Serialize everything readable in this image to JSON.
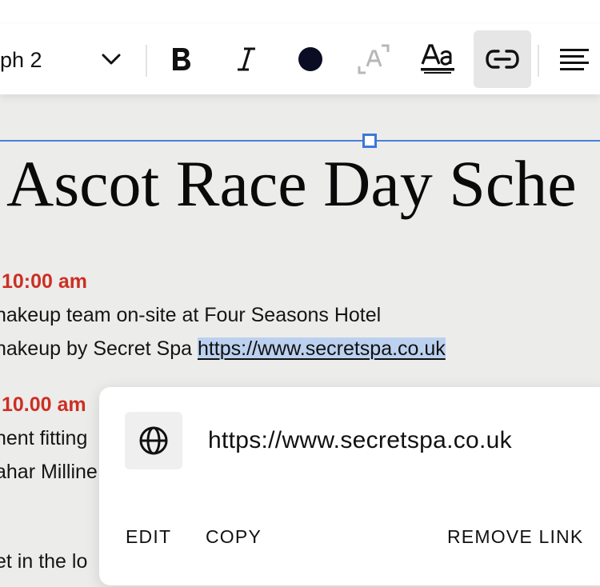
{
  "toolbar": {
    "style_dropdown": {
      "value": "ph 2"
    },
    "buttons": [
      {
        "name": "bold",
        "icon": "bold-icon"
      },
      {
        "name": "italic",
        "icon": "italic-icon"
      },
      {
        "name": "text-color",
        "icon": "color-circle-icon",
        "color": "#0b0d24"
      },
      {
        "name": "highlight",
        "icon": "text-highlight-icon",
        "disabled": true
      },
      {
        "name": "font",
        "icon": "font-style-icon"
      },
      {
        "name": "link",
        "icon": "link-icon",
        "active": true
      },
      {
        "name": "align",
        "icon": "align-left-icon"
      }
    ]
  },
  "document": {
    "heading": "Ascot Race Day Sche",
    "entries": [
      {
        "time": "10:00 am",
        "lines": [
          "nakeup team on-site at Four Seasons Hotel"
        ],
        "link_line_prefix": "nakeup by Secret Spa ",
        "link_text": "https://www.secretspa.co.uk"
      },
      {
        "time": "10.00 am",
        "lines": [
          "nent fitting",
          "ahar Milline"
        ]
      }
    ],
    "trailing_line": "et in the lo"
  },
  "link_popover": {
    "icon": "globe-icon",
    "url": "https://www.secretspa.co.uk",
    "edit_label": "EDIT",
    "copy_label": "COPY",
    "remove_label": "REMOVE LINK"
  },
  "colors": {
    "time_accent": "#cc2f22",
    "link_highlight": "#bcd1ef",
    "selection": "#3d78d8"
  }
}
